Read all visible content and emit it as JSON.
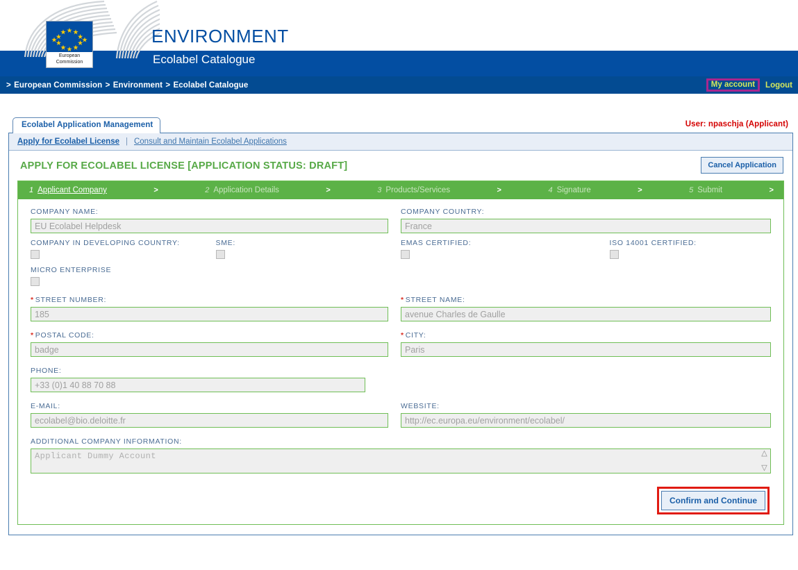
{
  "header": {
    "site_title": "ENVIRONMENT",
    "site_subtitle": "Ecolabel Catalogue",
    "flag_caption_line1": "European",
    "flag_caption_line2": "Commission"
  },
  "breadcrumb": {
    "items": [
      "European Commission",
      "Environment",
      "Ecolabel Catalogue"
    ],
    "separator": ">"
  },
  "user_links": {
    "my_account": "My account",
    "logout": "Logout",
    "my_account_highlight_color": "#A8268F"
  },
  "app": {
    "tab_label": "Ecolabel Application Management",
    "user_info": "User: npaschja (Applicant)",
    "user_info_color": "#D40000"
  },
  "subnav": {
    "active_item": "Apply for Ecolabel License",
    "separator": "|",
    "items": [
      "Consult and Maintain Ecolabel Applications"
    ]
  },
  "page": {
    "title": "APPLY FOR ECOLABEL LICENSE [APPLICATION STATUS: DRAFT]",
    "title_color": "#57A947",
    "cancel_button": "Cancel Application"
  },
  "steps": {
    "arrow": ">",
    "items": [
      {
        "num": "1",
        "label": "Applicant Company",
        "active": true
      },
      {
        "num": "2",
        "label": "Application Details",
        "active": false
      },
      {
        "num": "3",
        "label": "Products/Services",
        "active": false
      },
      {
        "num": "4",
        "label": "Signature",
        "active": false
      },
      {
        "num": "5",
        "label": "Submit",
        "active": false
      }
    ]
  },
  "form": {
    "company_name": {
      "label": "COMPANY NAME:",
      "value": "EU Ecolabel Helpdesk"
    },
    "company_country": {
      "label": "COMPANY COUNTRY:",
      "value": "France"
    },
    "developing_country": {
      "label": "COMPANY IN DEVELOPING COUNTRY:",
      "checked": false
    },
    "sme": {
      "label": "SME:",
      "checked": false
    },
    "emas_certified": {
      "label": "EMAS CERTIFIED:",
      "checked": false
    },
    "iso_certified": {
      "label": "ISO 14001 CERTIFIED:",
      "checked": false
    },
    "micro_enterprise": {
      "label": "MICRO ENTERPRISE",
      "checked": false
    },
    "street_number": {
      "label": "STREET NUMBER:",
      "value": "185",
      "required": true
    },
    "street_name": {
      "label": "STREET NAME:",
      "value": "avenue Charles de Gaulle",
      "required": true
    },
    "postal_code": {
      "label": "POSTAL CODE:",
      "value": "badge",
      "required": true
    },
    "city": {
      "label": "CITY:",
      "value": "Paris",
      "required": true
    },
    "phone": {
      "label": "PHONE:",
      "value": "+33 (0)1 40 88 70 88"
    },
    "email": {
      "label": "E-MAIL:",
      "value": "ecolabel@bio.deloitte.fr"
    },
    "website": {
      "label": "WEBSITE:",
      "value": "http://ec.europa.eu/environment/ecolabel/"
    },
    "additional_info": {
      "label": "ADDITIONAL COMPANY INFORMATION:",
      "value": "Applicant Dummy Account"
    },
    "required_marker": "*",
    "confirm_button": "Confirm and Continue",
    "confirm_highlight_color": "#E01B12",
    "input_border_color": "#6FBE55",
    "step_bar_color": "#5CB247"
  }
}
